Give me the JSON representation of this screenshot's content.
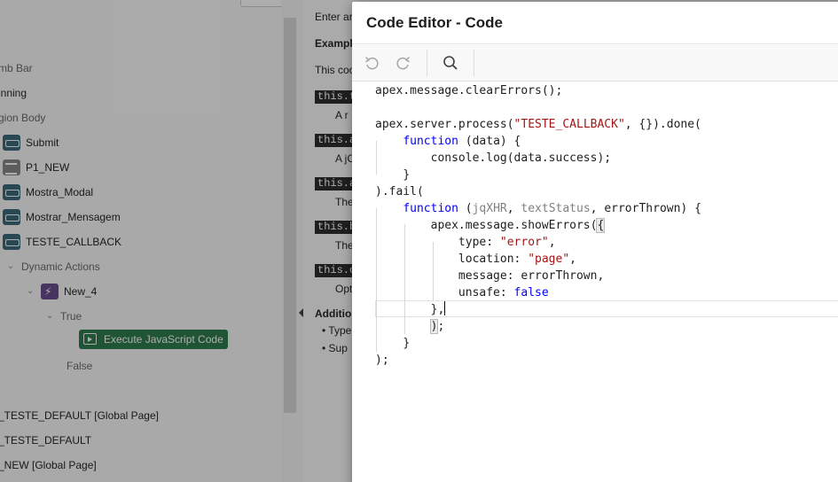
{
  "tree": {
    "items": [
      {
        "label": "mb Bar",
        "icon": "",
        "style": "section"
      },
      {
        "label": "inning",
        "icon": "",
        "style": "plain"
      },
      {
        "label": "gion Body",
        "icon": "",
        "style": "section"
      },
      {
        "label": "Submit",
        "icon": "button-icon",
        "style": "plain"
      },
      {
        "label": "P1_NEW",
        "icon": "page-item-icon",
        "style": "plain"
      },
      {
        "label": "Mostra_Modal",
        "icon": "button-icon",
        "style": "plain"
      },
      {
        "label": "Mostrar_Mensagem",
        "icon": "button-icon",
        "style": "plain"
      },
      {
        "label": "TESTE_CALLBACK",
        "icon": "button-icon",
        "style": "plain"
      },
      {
        "label": "Dynamic Actions",
        "icon": "chevron-down-icon",
        "style": "section"
      },
      {
        "label": "New_4",
        "icon": "dynamic-action-icon",
        "style": "plain"
      },
      {
        "label": "True",
        "icon": "chevron-down-icon",
        "style": "section"
      },
      {
        "label": "False",
        "icon": "",
        "style": "section"
      },
      {
        "label": "_TESTE_DEFAULT [Global Page]",
        "icon": "",
        "style": "plain"
      },
      {
        "label": "_TESTE_DEFAULT",
        "icon": "",
        "style": "plain"
      },
      {
        "label": "_NEW [Global Page]",
        "icon": "",
        "style": "plain"
      }
    ],
    "selected_action": "Execute JavaScript Code"
  },
  "help": {
    "enter": "Enter ar",
    "example": "Exampl",
    "this_code": "This coo",
    "tag1": "this.t",
    "desc1": "A r",
    "tag2": "this.a",
    "desc2": "A jC",
    "tag3": "this.a",
    "desc3": "The",
    "tag4": "this.b",
    "desc4": "The",
    "tag5": "this.c",
    "desc5": "Opt",
    "additional": "Additio",
    "bullet1": "• Type",
    "bullet2": "• Sup"
  },
  "dialog": {
    "title": "Code Editor - Code",
    "accent": "#2e7d4e"
  },
  "code": {
    "l1": "apex.message.clearErrors();",
    "l2_a": "apex.server.process(",
    "l2_str": "\"TESTE_CALLBACK\"",
    "l2_b": ", {}).done(",
    "l3_kw": "function",
    "l3_b": " (data) {",
    "l4": "console.log(data.success);",
    "l5": "}",
    "l6": ").fail(",
    "l7_kw": "function",
    "l7_a": " (",
    "l7_p1": "jqXHR",
    "l7_c1": ", ",
    "l7_p2": "textStatus",
    "l7_b": ", errorThrown) {",
    "l8_a": "apex.message.showErrors(",
    "l8_br": "{",
    "l9_a": "type: ",
    "l9_str": "\"error\"",
    "l9_c": ",",
    "l10_a": "location: ",
    "l10_str": "\"page\"",
    "l10_c": ",",
    "l11": "message: errorThrown,",
    "l12_a": "unsafe: ",
    "l12_kw": "false",
    "l13": "},",
    "l14_br": ")",
    "l14_c": ";",
    "l15": "}",
    "l16": ");"
  }
}
